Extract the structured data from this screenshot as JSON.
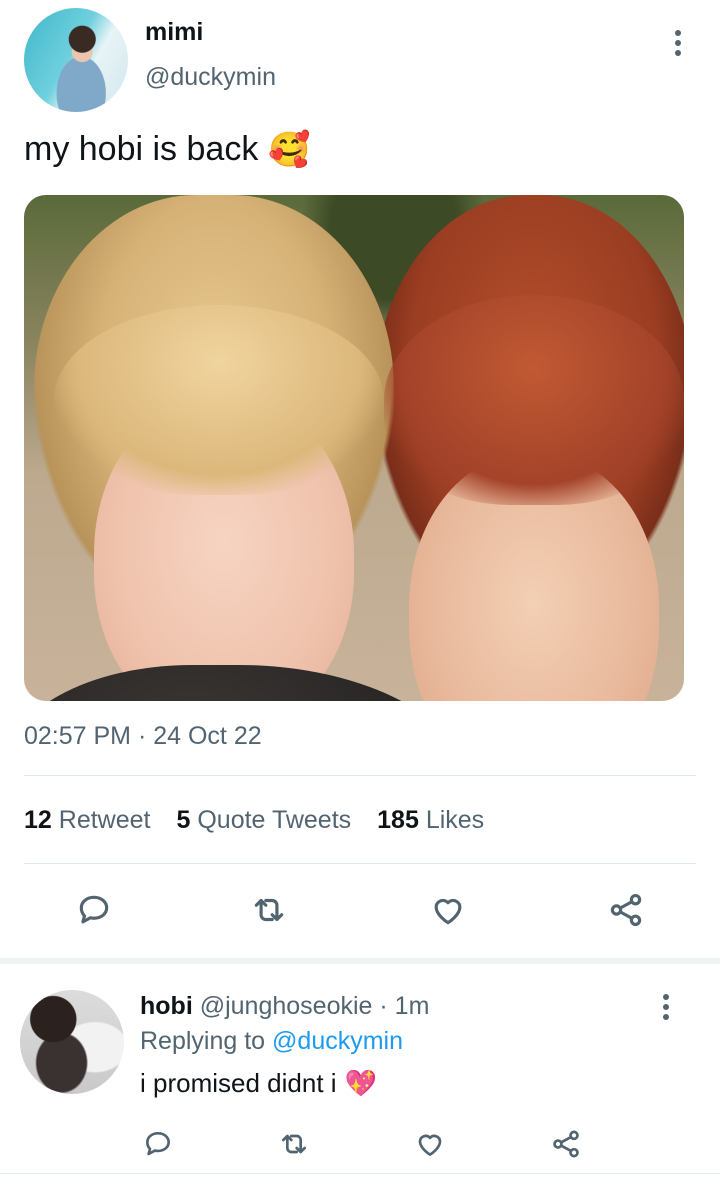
{
  "tweet": {
    "author_name": "mimi",
    "author_handle": "@duckymin",
    "text": "my hobi is back",
    "emoji": "🥰",
    "timestamp": "02:57 PM · 24 Oct 22",
    "stats": {
      "retweets_count": "12",
      "retweets_label": "Retweet",
      "quotes_count": "5",
      "quotes_label": "Quote Tweets",
      "likes_count": "185",
      "likes_label": "Likes"
    },
    "actions": [
      "reply-icon",
      "retweet-icon",
      "like-icon",
      "share-icon"
    ]
  },
  "reply": {
    "author_name": "hobi",
    "author_handle": "@junghoseokie",
    "separator": "·",
    "time_ago": "1m",
    "replying_prefix": "Replying to",
    "replying_mention": "@duckymin",
    "text": "i promised didnt i",
    "emoji": "💖",
    "actions": [
      "reply-icon",
      "retweet-icon",
      "like-icon",
      "share-icon"
    ]
  },
  "colors": {
    "text_primary": "#0f1419",
    "text_secondary": "#536471",
    "accent_blue": "#1d9bf0",
    "divider": "#e1e8ed"
  }
}
